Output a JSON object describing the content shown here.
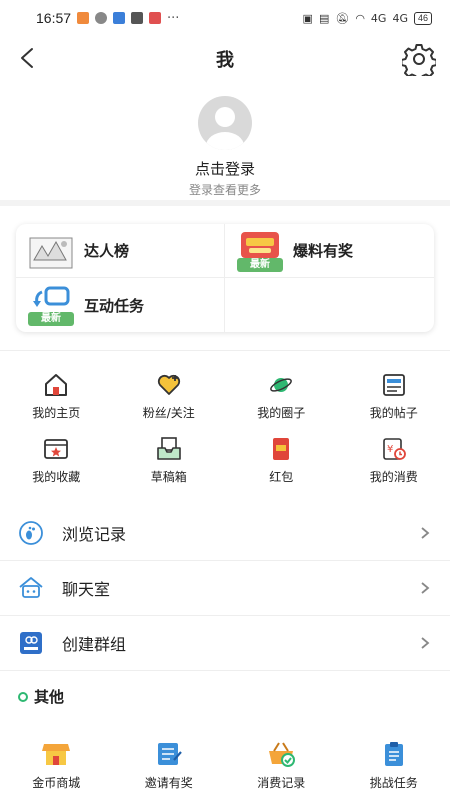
{
  "status_bar": {
    "time": "16:57",
    "battery": "46",
    "signal_1": "4G",
    "signal_2": "4G"
  },
  "nav": {
    "title": "我"
  },
  "profile": {
    "login": "点击登录",
    "sub": "登录查看更多"
  },
  "cards": [
    {
      "label": "达人榜",
      "icon": "ranking-icon",
      "tag": ""
    },
    {
      "label": "爆料有奖",
      "icon": "reward-icon",
      "tag": "最新"
    },
    {
      "label": "互动任务",
      "icon": "task-icon",
      "tag": "最新"
    }
  ],
  "grid": [
    {
      "label": "我的主页",
      "icon": "home-icon"
    },
    {
      "label": "粉丝/关注",
      "icon": "heart-plus-icon"
    },
    {
      "label": "我的圈子",
      "icon": "planet-icon"
    },
    {
      "label": "我的帖子",
      "icon": "post-icon"
    },
    {
      "label": "我的收藏",
      "icon": "star-folder-icon"
    },
    {
      "label": "草稿箱",
      "icon": "drafts-icon"
    },
    {
      "label": "红包",
      "icon": "red-packet-icon"
    },
    {
      "label": "我的消费",
      "icon": "spending-icon"
    }
  ],
  "list": [
    {
      "label": "浏览记录",
      "icon": "footprint-icon"
    },
    {
      "label": "聊天室",
      "icon": "chatroom-icon"
    },
    {
      "label": "创建群组",
      "icon": "create-group-icon"
    }
  ],
  "other": {
    "title": "其他",
    "items": [
      {
        "label": "金币商城",
        "icon": "shop-icon"
      },
      {
        "label": "邀请有奖",
        "icon": "invite-icon"
      },
      {
        "label": "消费记录",
        "icon": "basket-icon"
      },
      {
        "label": "挑战任务",
        "icon": "clipboard-icon"
      }
    ]
  },
  "colors": {
    "accent_green": "#2eb872",
    "tag_green": "#62b86a",
    "icon_blue": "#3b8fd9",
    "icon_red": "#e0463a",
    "icon_orange": "#f4a53a"
  }
}
